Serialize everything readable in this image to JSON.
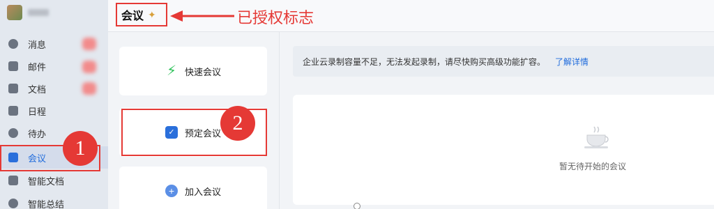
{
  "sidebar": {
    "items": [
      {
        "label": "消息"
      },
      {
        "label": "邮件"
      },
      {
        "label": "文档"
      },
      {
        "label": "日程"
      },
      {
        "label": "待办"
      },
      {
        "label": "会议"
      },
      {
        "label": "智能文档"
      },
      {
        "label": "智能总结"
      }
    ]
  },
  "header": {
    "title": "会议",
    "annotation": "已授权标志"
  },
  "actions": {
    "quick": "快速会议",
    "schedule": "预定会议",
    "join": "加入会议"
  },
  "notice": {
    "text": "企业云录制容量不足，无法发起录制，请尽快购买高级功能扩容。",
    "link": "了解详情"
  },
  "empty_state": {
    "text": "暂无待开始的会议"
  },
  "callouts": {
    "one": "1",
    "two": "2"
  },
  "colors": {
    "annotation_red": "#e53935",
    "accent_blue": "#1f6bdc",
    "bolt_green": "#2fc25b"
  }
}
